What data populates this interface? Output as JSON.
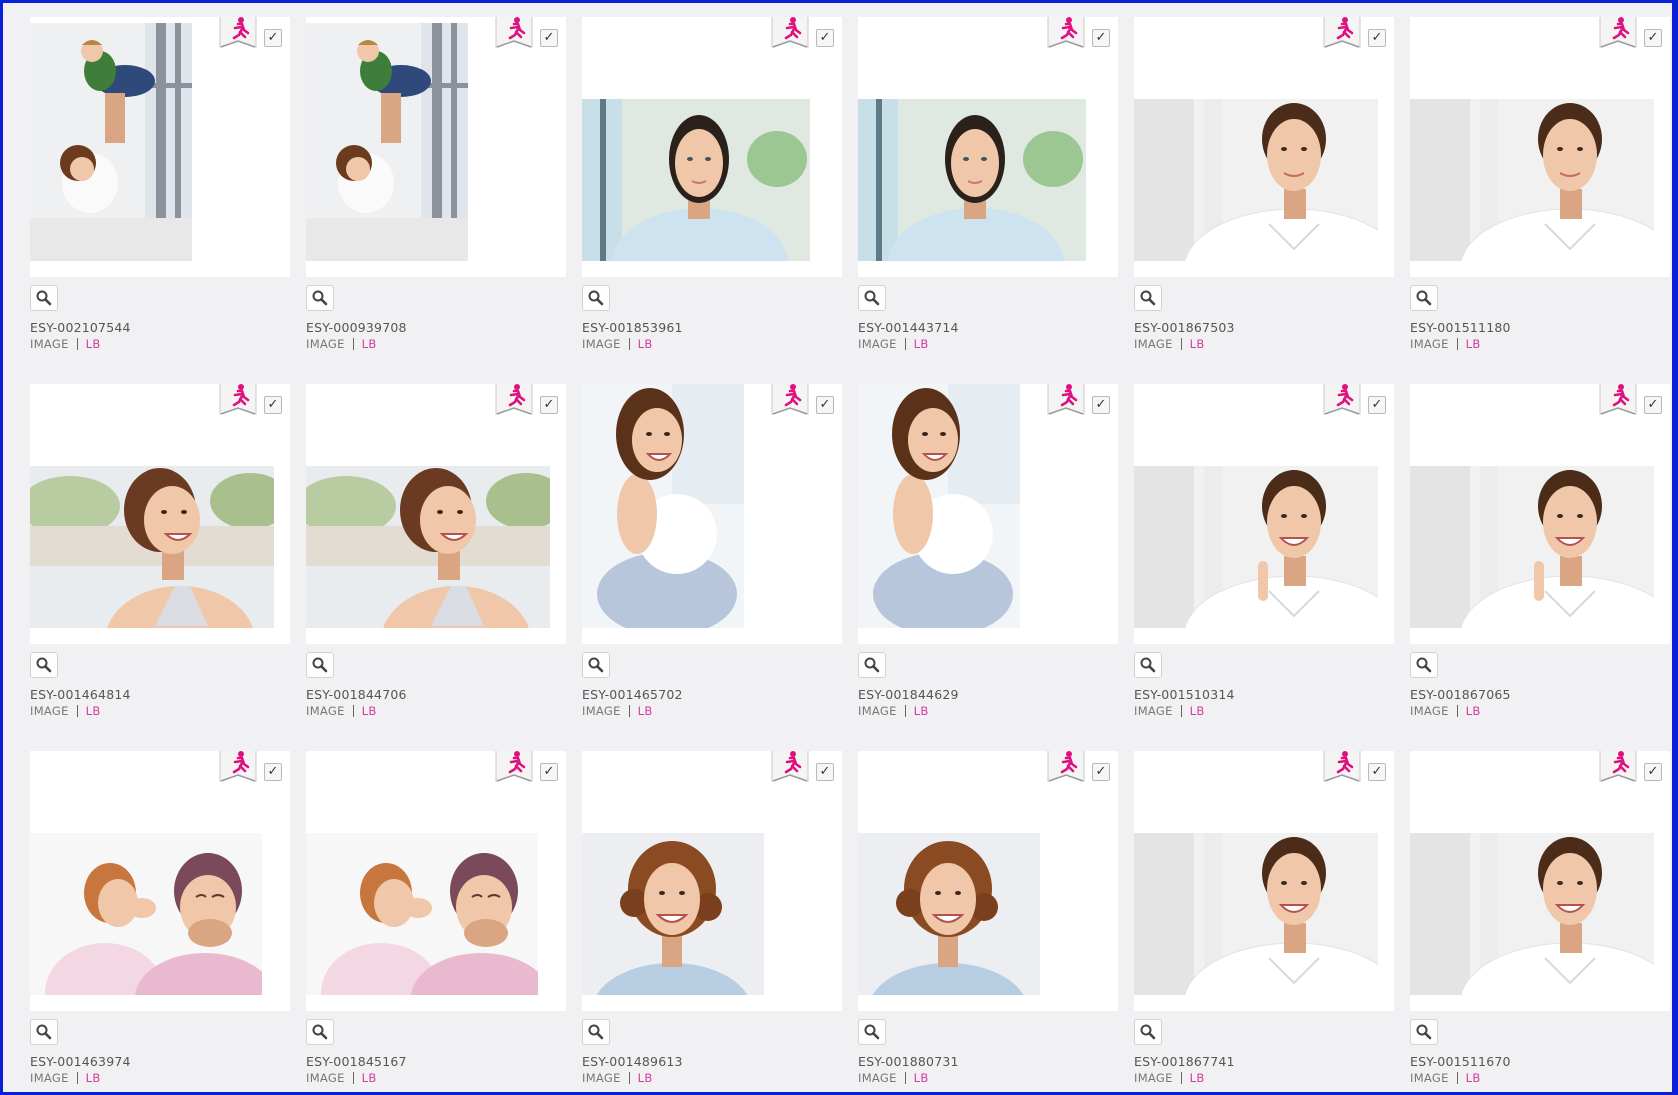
{
  "accent_color": "#e0117f",
  "lightbox_color": "#d43aa0",
  "items": [
    {
      "code": "ESY-002107544",
      "type": "IMAGE",
      "lb": "LB",
      "subject": "father-lifting-child"
    },
    {
      "code": "ESY-000939708",
      "type": "IMAGE",
      "lb": "LB",
      "subject": "father-lifting-child"
    },
    {
      "code": "ESY-001853961",
      "type": "IMAGE",
      "lb": "LB",
      "subject": "woman-light-blue-shirt"
    },
    {
      "code": "ESY-001443714",
      "type": "IMAGE",
      "lb": "LB",
      "subject": "woman-light-blue-shirt"
    },
    {
      "code": "ESY-001867503",
      "type": "IMAGE",
      "lb": "LB",
      "subject": "woman-white-shirt"
    },
    {
      "code": "ESY-001511180",
      "type": "IMAGE",
      "lb": "LB",
      "subject": "woman-white-shirt"
    },
    {
      "code": "ESY-001464814",
      "type": "IMAGE",
      "lb": "LB",
      "subject": "smiling-woman-outdoors"
    },
    {
      "code": "ESY-001844706",
      "type": "IMAGE",
      "lb": "LB",
      "subject": "smiling-woman-outdoors"
    },
    {
      "code": "ESY-001465702",
      "type": "IMAGE",
      "lb": "LB",
      "subject": "woman-sitting-smiling"
    },
    {
      "code": "ESY-001844629",
      "type": "IMAGE",
      "lb": "LB",
      "subject": "woman-sitting-smiling"
    },
    {
      "code": "ESY-001510314",
      "type": "IMAGE",
      "lb": "LB",
      "subject": "woman-thinking-smile"
    },
    {
      "code": "ESY-001867065",
      "type": "IMAGE",
      "lb": "LB",
      "subject": "woman-thinking-smile"
    },
    {
      "code": "ESY-001463974",
      "type": "IMAGE",
      "lb": "LB",
      "subject": "girl-whispering-grandmother"
    },
    {
      "code": "ESY-001845167",
      "type": "IMAGE",
      "lb": "LB",
      "subject": "girl-whispering-grandmother"
    },
    {
      "code": "ESY-001489613",
      "type": "IMAGE",
      "lb": "LB",
      "subject": "curly-hair-woman-smiling"
    },
    {
      "code": "ESY-001880731",
      "type": "IMAGE",
      "lb": "LB",
      "subject": "curly-hair-woman-smiling"
    },
    {
      "code": "ESY-001867741",
      "type": "IMAGE",
      "lb": "LB",
      "subject": "woman-white-shirt-smile"
    },
    {
      "code": "ESY-001511670",
      "type": "IMAGE",
      "lb": "LB",
      "subject": "woman-white-shirt-smile"
    }
  ]
}
